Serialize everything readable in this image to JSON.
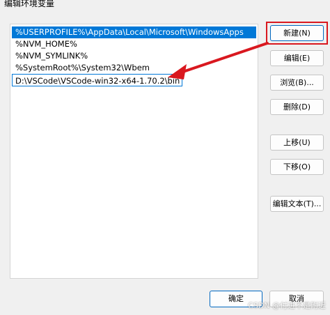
{
  "window": {
    "title": "编辑环境变量"
  },
  "list": {
    "items": [
      {
        "text": "%USERPROFILE%\\AppData\\Local\\Microsoft\\WindowsApps"
      },
      {
        "text": "%NVM_HOME%"
      },
      {
        "text": "%NVM_SYMLINK%"
      },
      {
        "text": "%SystemRoot%\\System32\\Wbem"
      },
      {
        "text": "D:\\VSCode\\VSCode-win32-x64-1.70.2\\bin"
      }
    ]
  },
  "buttons": {
    "new": "新建(N)",
    "edit": "编辑(E)",
    "browse": "浏览(B)...",
    "delete": "删除(D)",
    "move_up": "上移(U)",
    "move_down": "下移(O)",
    "edit_text": "编辑文本(T)..."
  },
  "footer": {
    "ok": "确定",
    "cancel": "取消"
  },
  "watermark": {
    "text": "CSDN @付进不是附近"
  },
  "colors": {
    "selection": "#0078d7",
    "annotation_red": "#d9181f",
    "background": "#f0f0f0"
  }
}
